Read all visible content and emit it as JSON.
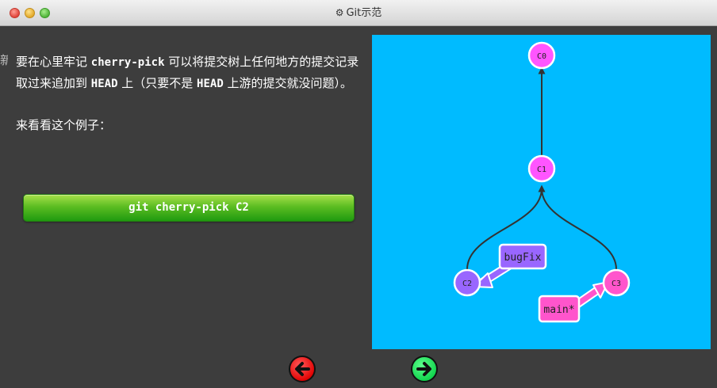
{
  "window": {
    "title": "Git示范"
  },
  "left_edge_text": "新",
  "lesson": {
    "line1_pre": "要在心里牢记 ",
    "line1_code": "cherry-pick",
    "line1_mid": " 可以将提交树上任何地方的提交记录取过来追加到 ",
    "line1_code2": "HEAD",
    "line1_mid2": " 上（只要不是 ",
    "line1_code3": "HEAD",
    "line1_post": " 上游的提交就没问题）。",
    "line2": "来看看这个例子："
  },
  "command_button": {
    "label": "git cherry-pick C2"
  },
  "tree": {
    "commits": [
      "C0",
      "C1",
      "C2",
      "C3"
    ],
    "branches": [
      {
        "name": "bugFix",
        "points_to": "C2",
        "color": "#9966ff"
      },
      {
        "name": "main*",
        "points_to": "C3",
        "color": "#ff55cc"
      }
    ],
    "colors": {
      "background": "#00bbff",
      "commit_main": "#ff55ff",
      "commit_bugfix": "#9966ff",
      "edge": "#333333"
    }
  },
  "nav": {
    "back": "arrow-left-icon",
    "forward": "arrow-right-icon"
  }
}
